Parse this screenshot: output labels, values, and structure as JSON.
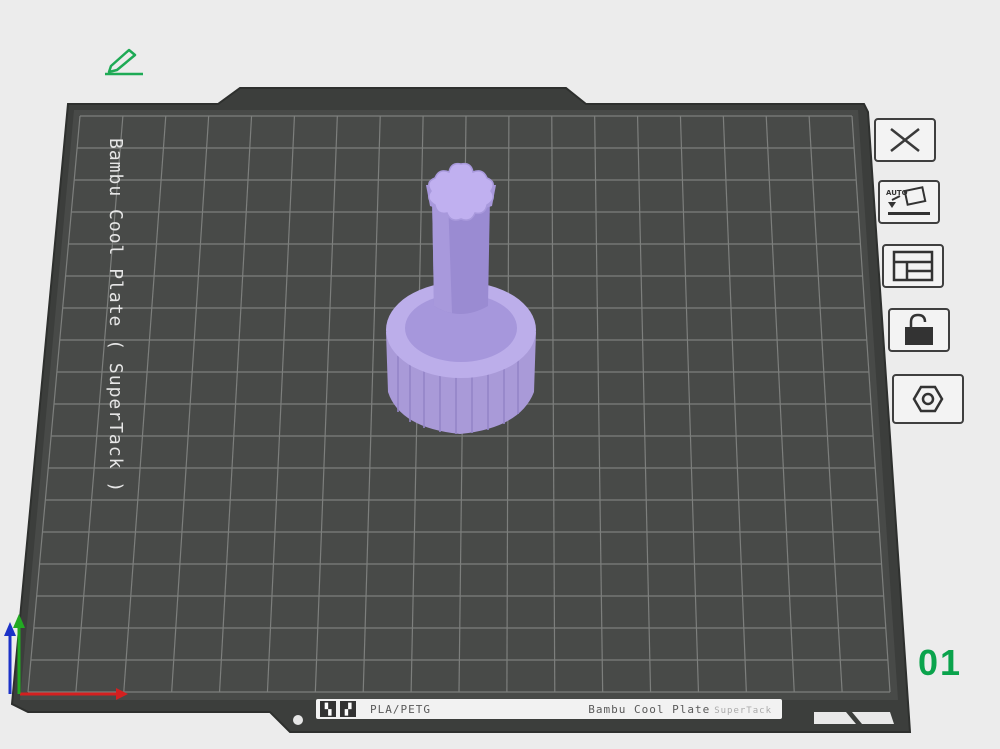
{
  "plate": {
    "name_vertical": "Bambu Cool Plate ( SuperTack )",
    "number": "01"
  },
  "bottom_bar": {
    "filament": "PLA/PETG",
    "plate_name": "Bambu Cool Plate",
    "plate_sub": "SuperTack"
  },
  "toolbar": {
    "items": [
      {
        "name": "close-icon"
      },
      {
        "name": "auto-orient-icon",
        "badge": "AUTO"
      },
      {
        "name": "arrange-icon"
      },
      {
        "name": "unlock-icon"
      },
      {
        "name": "plate-settings-icon"
      }
    ]
  },
  "colors": {
    "bed": "#484a48",
    "grid": "#7d7f7d",
    "model": "#b6a4e6",
    "number": "#0aa34c",
    "edit_icon": "#1eaa55"
  }
}
